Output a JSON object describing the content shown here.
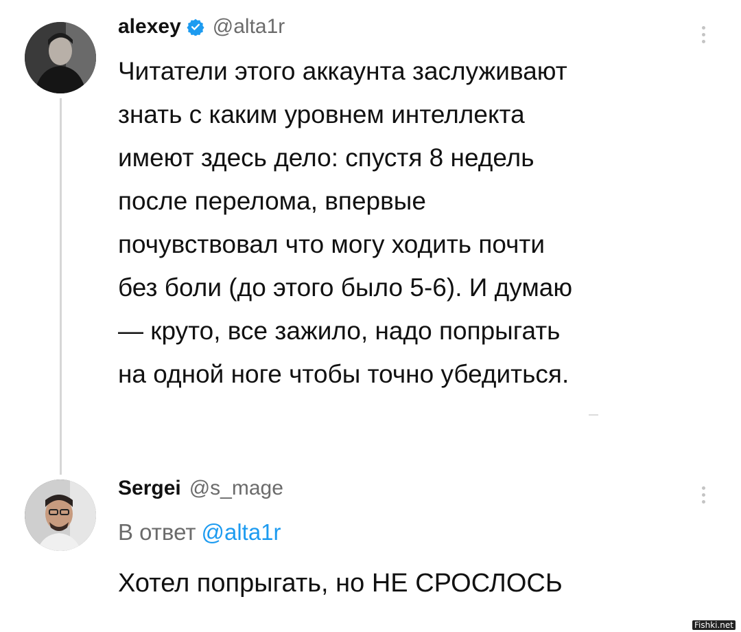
{
  "tweets": [
    {
      "display_name": "alexey",
      "handle": "@alta1r",
      "verified": true,
      "text_lines": [
        "Читатели этого аккаунта заслуживают",
        "знать с каким уровнем интеллекта",
        "имеют здесь дело: спустя 8 недель",
        "после перелома, впервые",
        "почувствовал что могу ходить почти",
        "без боли (до этого было 5-6). И думаю",
        "— круто, все зажило, надо попрыгать",
        "на одной ноге чтобы точно убедиться."
      ]
    },
    {
      "display_name": "Sergei",
      "handle": "@s_mage",
      "reply_prefix": "В ответ",
      "reply_mention": "@alta1r",
      "text": "Хотел попрыгать, но НЕ СРОСЛОСЬ"
    }
  ],
  "watermark": "Fishki.net",
  "colors": {
    "text": "#111111",
    "muted": "#6b6b6b",
    "link": "#1d9bf0",
    "verified": "#1d9bf0",
    "thread_line": "#d6d6d6"
  },
  "icons": {
    "verified": "verified-badge-icon",
    "more": "more-options-icon"
  }
}
